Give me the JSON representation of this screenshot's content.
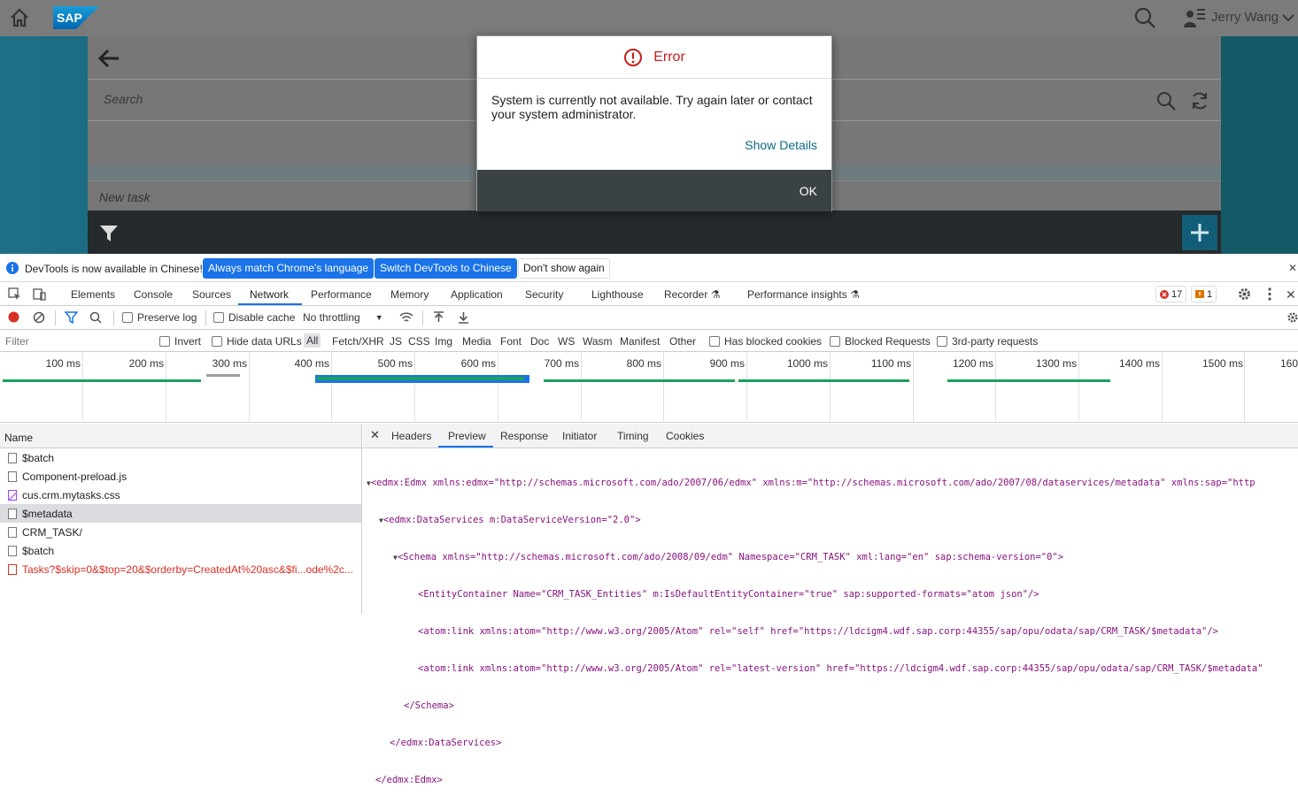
{
  "shell": {
    "logo": "SAP",
    "user_name": "Jerry Wang"
  },
  "app": {
    "search_placeholder": "Search",
    "new_task_placeholder": "New task",
    "add_label": "+"
  },
  "dialog": {
    "title": "Error",
    "message": "System is currently not available. Try again later or contact your system administrator.",
    "show_details": "Show Details",
    "ok": "OK"
  },
  "infobar": {
    "text": "DevTools is now available in Chinese!",
    "btn_match": "Always match Chrome's language",
    "btn_switch": "Switch DevTools to Chinese",
    "btn_dont": "Don't show again"
  },
  "tabs": [
    "Elements",
    "Console",
    "Sources",
    "Network",
    "Performance",
    "Memory",
    "Application",
    "Security",
    "Lighthouse",
    "Recorder",
    "Performance insights"
  ],
  "badges": {
    "errors": "17",
    "warnings": "1"
  },
  "toolbar": {
    "preserve_log": "Preserve log",
    "disable_cache": "Disable cache",
    "throttling": "No throttling"
  },
  "filter": {
    "placeholder": "Filter",
    "invert": "Invert",
    "hide_data_urls": "Hide data URLs",
    "types": [
      "All",
      "Fetch/XHR",
      "JS",
      "CSS",
      "Img",
      "Media",
      "Font",
      "Doc",
      "WS",
      "Wasm",
      "Manifest",
      "Other"
    ],
    "blocked_cookies": "Has blocked cookies",
    "blocked_requests": "Blocked Requests",
    "third_party": "3rd-party requests"
  },
  "timeline_ticks": [
    "100 ms",
    "200 ms",
    "300 ms",
    "400 ms",
    "500 ms",
    "600 ms",
    "700 ms",
    "800 ms",
    "900 ms",
    "1000 ms",
    "1100 ms",
    "1200 ms",
    "1300 ms",
    "1400 ms",
    "1500 ms",
    "160"
  ],
  "colors": {
    "shell": "#7b7b7b",
    "accent": "#1a73e8",
    "error": "#d93025",
    "bar_green": "#1aa260",
    "bar_blue": "#1a73e8"
  },
  "requests": {
    "header": "Name",
    "items": [
      "$batch",
      "Component-preload.js",
      "cus.crm.mytasks.css",
      "$metadata",
      "CRM_TASK/",
      "$batch",
      "Tasks?$skip=0&$top=20&$orderby=CreatedAt%20asc&$fi...ode%2c..."
    ]
  },
  "detail_tabs": [
    "Headers",
    "Preview",
    "Response",
    "Initiator",
    "Timing",
    "Cookies"
  ],
  "preview_lines": [
    "<edmx:Edmx xmlns:edmx=\"http://schemas.microsoft.com/ado/2007/06/edmx\" xmlns:m=\"http://schemas.microsoft.com/ado/2007/08/dataservices/metadata\" xmlns:sap=\"http",
    "<edmx:DataServices m:DataServiceVersion=\"2.0\">",
    "<Schema xmlns=\"http://schemas.microsoft.com/ado/2008/09/edm\" Namespace=\"CRM_TASK\" xml:lang=\"en\" sap:schema-version=\"0\">",
    "<EntityContainer Name=\"CRM_TASK_Entities\" m:IsDefaultEntityContainer=\"true\" sap:supported-formats=\"atom json\"/>",
    "<atom:link xmlns:atom=\"http://www.w3.org/2005/Atom\" rel=\"self\" href=\"https://ldcigm4.wdf.sap.corp:44355/sap/opu/odata/sap/CRM_TASK/$metadata\"/>",
    "<atom:link xmlns:atom=\"http://www.w3.org/2005/Atom\" rel=\"latest-version\" href=\"https://ldcigm4.wdf.sap.corp:44355/sap/opu/odata/sap/CRM_TASK/$metadata\"",
    "</Schema>",
    "</edmx:DataServices>",
    "</edmx:Edmx>"
  ]
}
